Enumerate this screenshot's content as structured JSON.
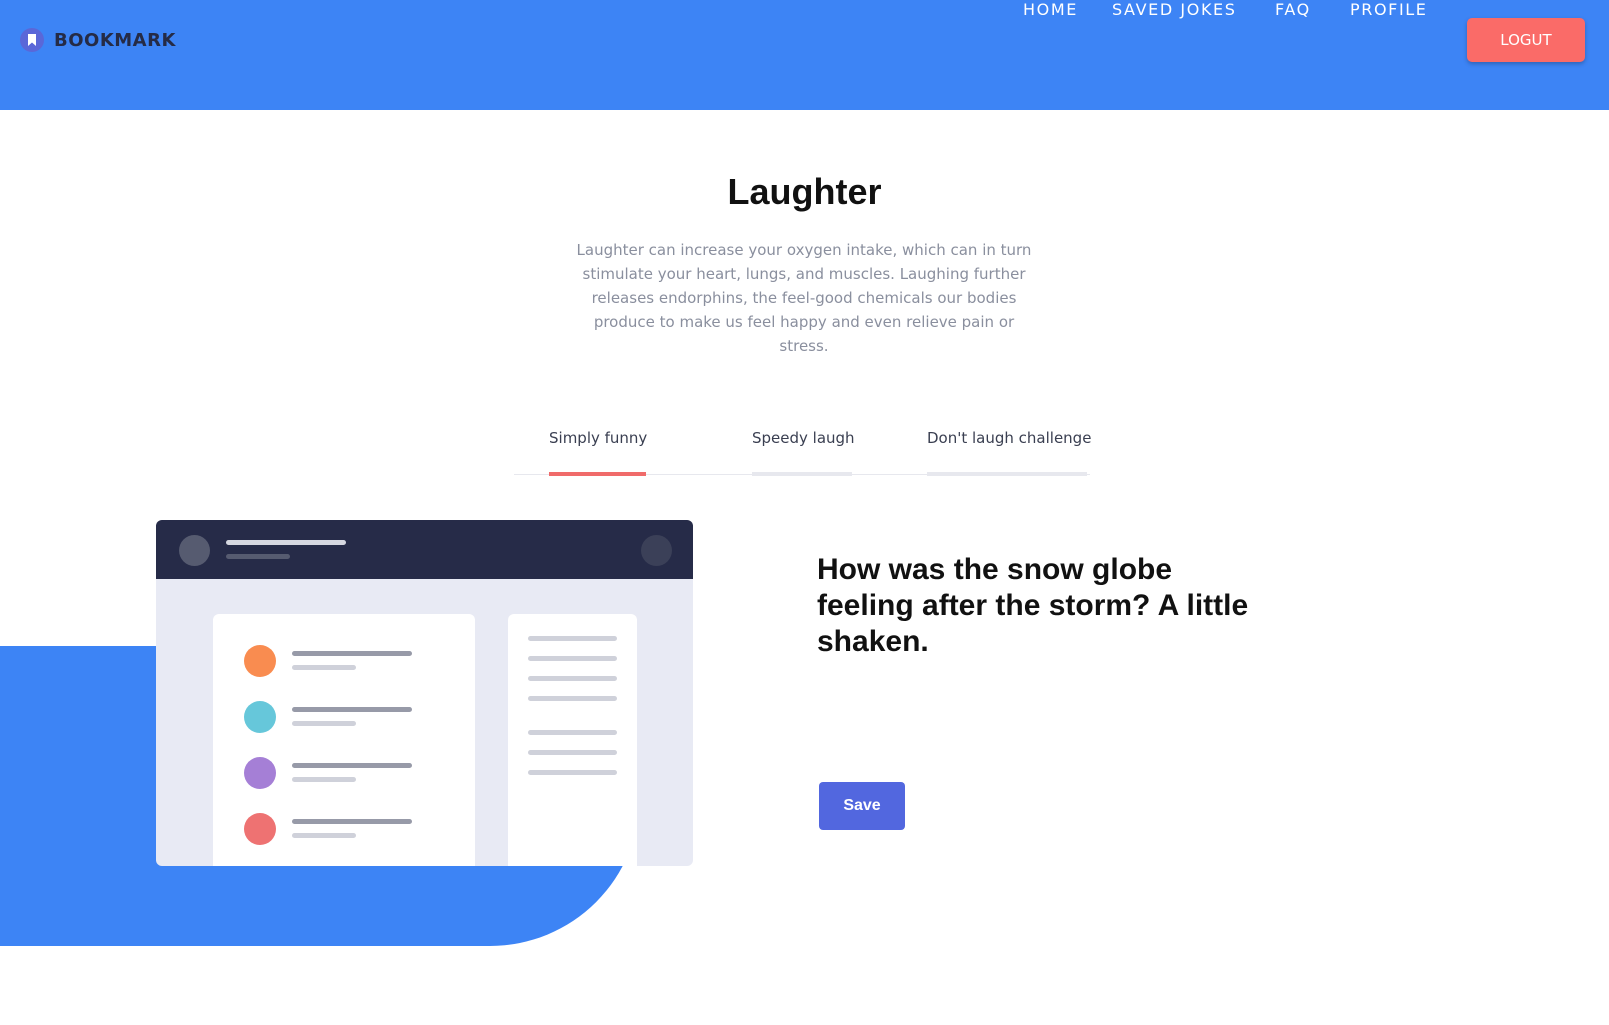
{
  "header": {
    "brand": "BOOKMARK",
    "nav": [
      {
        "label": "HOME"
      },
      {
        "label": "SAVED JOKES"
      },
      {
        "label": "FAQ"
      },
      {
        "label": "PROFILE"
      }
    ],
    "logout_label": "LOGUT",
    "colors": {
      "bar": "#3d84f5",
      "logout": "#fa6b68"
    }
  },
  "intro": {
    "title": "Laughter",
    "description": "Laughter can increase your oxygen intake, which can in turn stimulate your heart, lungs, and muscles. Laughing further releases endorphins, the feel-good chemicals our bodies produce to make us feel happy and even relieve pain or stress."
  },
  "tabs": [
    {
      "label": "Simply funny",
      "active": true
    },
    {
      "label": "Speedy laugh",
      "active": false
    },
    {
      "label": "Don't laugh challenge",
      "active": false
    }
  ],
  "joke": {
    "text": "How was the snow globe feeling after the storm? A little shaken.",
    "save_label": "Save"
  },
  "illustration": {
    "icon": "app-mockup-illustration",
    "dot_colors": [
      "#f98c50",
      "#66c7da",
      "#a57fd6",
      "#ee7272"
    ]
  }
}
